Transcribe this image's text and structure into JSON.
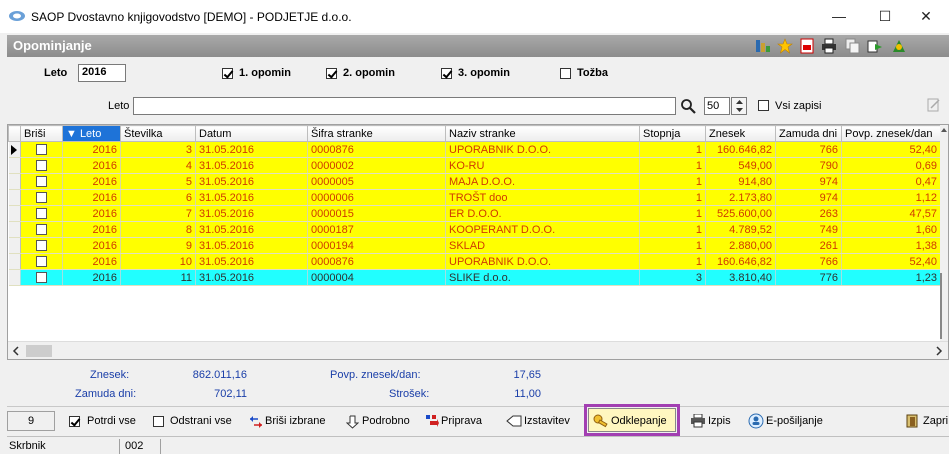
{
  "window": {
    "title": "SAOP Dvostavno knjigovodstvo [DEMO] - PODJETJE d.o.o.",
    "minimize": "—",
    "maximize": "☐",
    "close": "✕"
  },
  "module": {
    "title": "Opominjanje",
    "toolbar_icons": [
      "grid-icon",
      "star-icon",
      "pdf-icon",
      "print-icon",
      "copy-icon",
      "export-icon",
      "exit-icon"
    ]
  },
  "filters": {
    "year_label": "Leto",
    "year_value": "2016",
    "opomin1": "1. opomin",
    "opomin2": "2. opomin",
    "opomin3": "3. opomin",
    "tozba": "Tožba"
  },
  "search": {
    "label": "Leto",
    "value": "",
    "count": "50",
    "all_records": "Vsi zapisi"
  },
  "table": {
    "columns": [
      "Briši",
      "▼ Leto",
      "Številka",
      "Datum",
      "Šifra stranke",
      "Naziv stranke",
      "Stopnja",
      "Znesek",
      "Zamuda dni",
      "Povp. znesek/dan"
    ],
    "rows": [
      {
        "leto": "2016",
        "stevilka": "3",
        "datum": "31.05.2016",
        "sifra": "0000876",
        "naziv": "UPORABNIK D.O.O.",
        "stopnja": "1",
        "znesek": "160.646,82",
        "zamuda": "766",
        "povp": "52,40"
      },
      {
        "leto": "2016",
        "stevilka": "4",
        "datum": "31.05.2016",
        "sifra": "0000002",
        "naziv": "KO-RU",
        "stopnja": "1",
        "znesek": "549,00",
        "zamuda": "790",
        "povp": "0,69"
      },
      {
        "leto": "2016",
        "stevilka": "5",
        "datum": "31.05.2016",
        "sifra": "0000005",
        "naziv": "MAJA D.O.O.",
        "stopnja": "1",
        "znesek": "914,80",
        "zamuda": "974",
        "povp": "0,47"
      },
      {
        "leto": "2016",
        "stevilka": "6",
        "datum": "31.05.2016",
        "sifra": "0000006",
        "naziv": "TROŠT doo",
        "stopnja": "1",
        "znesek": "2.173,80",
        "zamuda": "974",
        "povp": "1,12"
      },
      {
        "leto": "2016",
        "stevilka": "7",
        "datum": "31.05.2016",
        "sifra": "0000015",
        "naziv": "ER D.O.O.",
        "stopnja": "1",
        "znesek": "525.600,00",
        "zamuda": "263",
        "povp": "47,57"
      },
      {
        "leto": "2016",
        "stevilka": "8",
        "datum": "31.05.2016",
        "sifra": "0000187",
        "naziv": "KOOPERANT D.O.O.",
        "stopnja": "1",
        "znesek": "4.789,52",
        "zamuda": "749",
        "povp": "1,60"
      },
      {
        "leto": "2016",
        "stevilka": "9",
        "datum": "31.05.2016",
        "sifra": "0000194",
        "naziv": "SKLAD",
        "stopnja": "1",
        "znesek": "2.880,00",
        "zamuda": "261",
        "povp": "1,38"
      },
      {
        "leto": "2016",
        "stevilka": "10",
        "datum": "31.05.2016",
        "sifra": "0000876",
        "naziv": "UPORABNIK D.O.O.",
        "stopnja": "1",
        "znesek": "160.646,82",
        "zamuda": "766",
        "povp": "52,40"
      },
      {
        "leto": "2016",
        "stevilka": "11",
        "datum": "31.05.2016",
        "sifra": "0000004",
        "naziv": "SLIKE d.o.o.",
        "stopnja": "3",
        "znesek": "3.810,40",
        "zamuda": "776",
        "povp": "1,23"
      }
    ]
  },
  "totals": {
    "znesek_label": "Znesek:",
    "znesek_value": "862.011,16",
    "zamuda_label": "Zamuda dni:",
    "zamuda_value": "702,11",
    "povp_label": "Povp. znesek/dan:",
    "povp_value": "17,65",
    "strosek_label": "Strošek:",
    "strosek_value": "11,00"
  },
  "toolbar": {
    "count": "9",
    "potrdi_vse": "Potrdi vse",
    "odstrani_vse": "Odstrani vse",
    "brisi_izbrane": "Briši izbrane",
    "podrobno": "Podrobno",
    "priprava": "Priprava",
    "izstavitev": "Izstavitev",
    "odklepanje": "Odklepanje",
    "izpis": "Izpis",
    "eposiljanje": "E-pošiljanje",
    "zapri": "Zapri"
  },
  "status": {
    "user": "Skrbnik",
    "code": "002"
  },
  "colors": {
    "row_yellow": "#ffff00",
    "row_selected": "#21ffff",
    "text_red": "#d03a00",
    "totals_blue": "#1a3ea8",
    "highlight_purple": "#a23fb2"
  }
}
